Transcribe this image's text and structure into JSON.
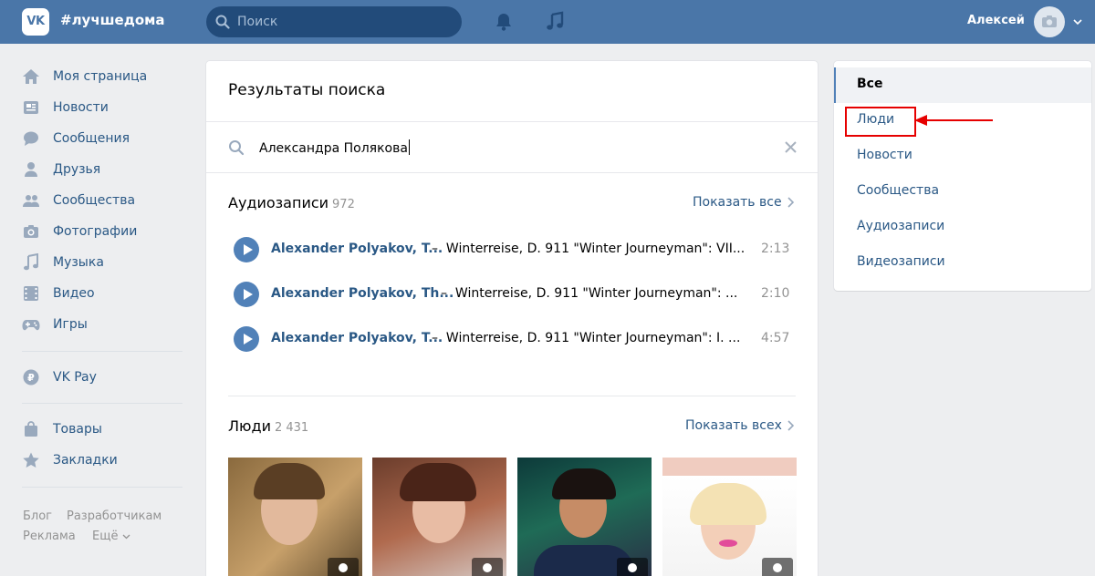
{
  "header": {
    "logo_text": "VK",
    "brand": "#лучшедома",
    "search_placeholder": "Поиск",
    "user_name": "Алексей",
    "bg_color": "#4a76a8"
  },
  "nav": {
    "items": [
      {
        "label": "Моя страница",
        "icon": "home-icon"
      },
      {
        "label": "Новости",
        "icon": "news-icon"
      },
      {
        "label": "Сообщения",
        "icon": "messages-icon"
      },
      {
        "label": "Друзья",
        "icon": "friends-icon"
      },
      {
        "label": "Сообщества",
        "icon": "groups-icon"
      },
      {
        "label": "Фотографии",
        "icon": "camera-icon"
      },
      {
        "label": "Музыка",
        "icon": "music-note-icon"
      },
      {
        "label": "Видео",
        "icon": "video-icon"
      },
      {
        "label": "Игры",
        "icon": "gamepad-icon"
      },
      {
        "label": "VK Pay",
        "icon": "vkpay-icon"
      },
      {
        "label": "Товары",
        "icon": "bag-icon"
      },
      {
        "label": "Закладки",
        "icon": "star-icon"
      }
    ],
    "footer": [
      "Блог",
      "Разработчикам",
      "Реклама",
      "Ещё"
    ]
  },
  "main": {
    "title": "Результаты поиска",
    "query": "Александра Полякова",
    "audio": {
      "title": "Аудиозаписи",
      "count": "972",
      "show_all": "Показать все",
      "tracks": [
        {
          "artist": "Alexander Polyakov, T...",
          "song": "Winterreise, D. 911 \"Winter Journeyman\": VII...",
          "duration": "2:13"
        },
        {
          "artist": "Alexander Polyakov, Th...",
          "song": "Winterreise, D. 911 \"Winter Journeyman\": ...",
          "duration": "2:10"
        },
        {
          "artist": "Alexander Polyakov, T...",
          "song": "Winterreise, D. 911 \"Winter Journeyman\": I. ...",
          "duration": "4:57"
        }
      ]
    },
    "people": {
      "title": "Люди",
      "count": "2 431",
      "show_all": "Показать всех"
    }
  },
  "filter": {
    "items": [
      "Все",
      "Люди",
      "Новости",
      "Сообщества",
      "Аудиозаписи",
      "Видеозаписи"
    ],
    "active": "Все",
    "highlighted": "Люди",
    "highlight_color": "#e60000"
  }
}
